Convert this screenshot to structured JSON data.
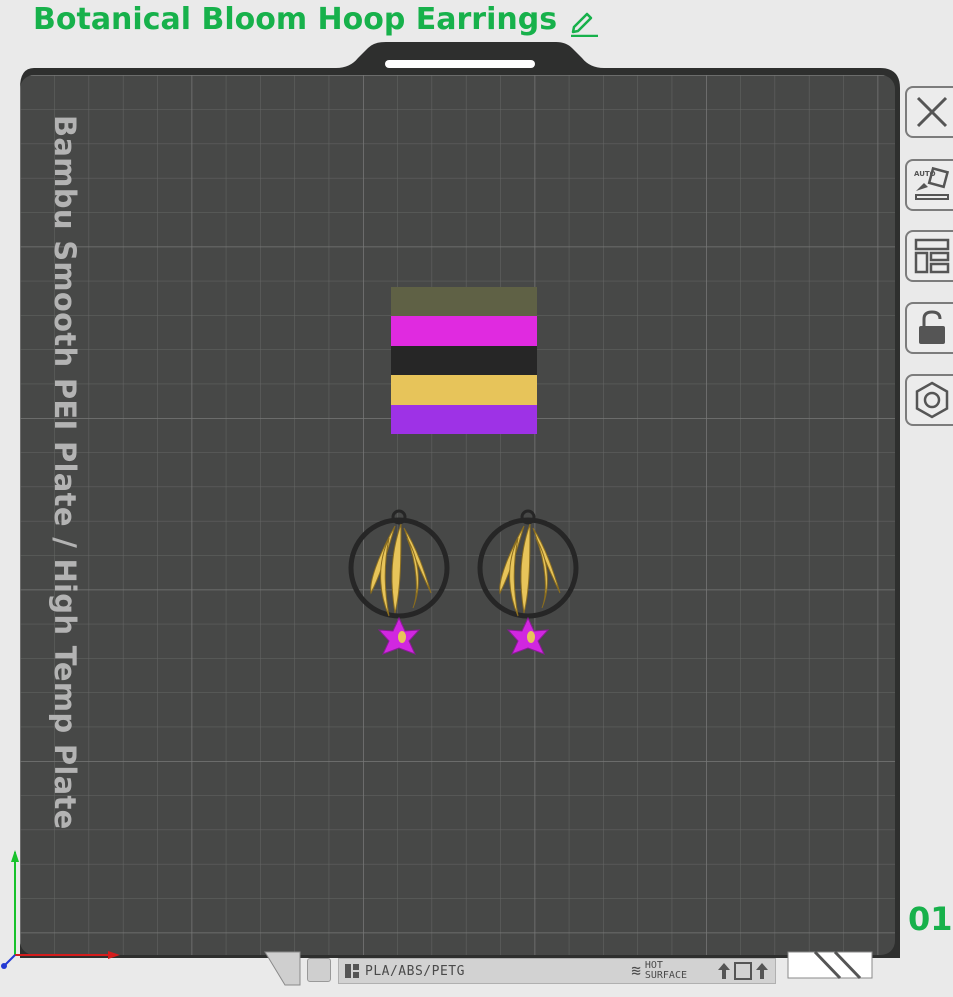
{
  "project": {
    "title": "Botanical Bloom Hoop Earrings"
  },
  "plate": {
    "label": "Bambu Smooth PEI Plate / High Temp Plate",
    "number": "01",
    "material": "PLA/ABS/PETG",
    "hot_line1": "HOT",
    "hot_line2": "SURFACE"
  },
  "toolbar": {
    "close": "close-icon",
    "auto_orient": "auto-orient-icon",
    "arrange": "arrange-icon",
    "lock": "lock-icon",
    "settings": "hex-settings-icon"
  },
  "colors": {
    "accent": "#17b14b",
    "plate_bg": "#474847",
    "filament": [
      "#5f6145",
      "#e02ae0",
      "#262626",
      "#e7c45a",
      "#9e32e6"
    ]
  }
}
